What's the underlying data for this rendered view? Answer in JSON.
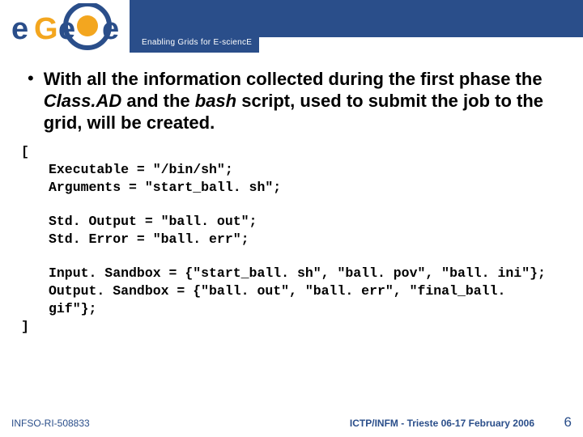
{
  "header": {
    "tagline": "Enabling Grids for E-sciencE"
  },
  "bullet": {
    "pre": "With all the information collected during the first phase the ",
    "em1": "Class.AD",
    "mid": " and the ",
    "em2": "bash",
    "post": " script, used to submit the job to the grid, will be created."
  },
  "code": {
    "open": "[",
    "l1": "Executable = \"/bin/sh\";",
    "l2": "Arguments = \"start_ball. sh\";",
    "l3": "Std. Output = \"ball. out\";",
    "l4": "Std. Error = \"ball. err\";",
    "l5": "Input. Sandbox = {\"start_ball. sh\", \"ball. pov\", \"ball. ini\"};",
    "l6": "Output. Sandbox = {\"ball. out\", \"ball. err\", \"final_ball. gif\"};",
    "close": "]"
  },
  "footer": {
    "left": "INFSO-RI-508833",
    "center": "ICTP/INFM - Trieste 06-17 February 2006",
    "page": "6"
  }
}
